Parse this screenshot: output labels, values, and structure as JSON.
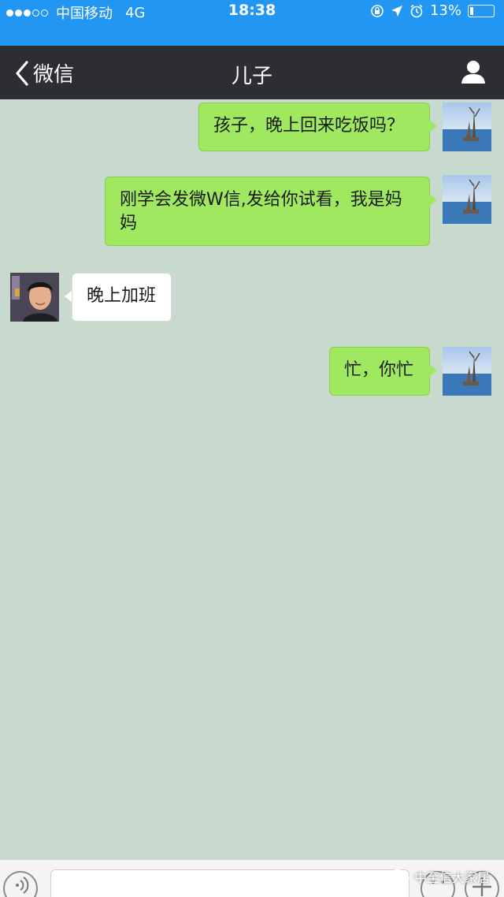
{
  "status_bar": {
    "carrier": "中国移动",
    "network": "4G",
    "time": "18:38",
    "battery": "13%"
  },
  "banner": {
    "text": "..."
  },
  "nav": {
    "back_label": "微信",
    "title": "儿子"
  },
  "messages": [
    {
      "sender": "me",
      "text": "孩子，晚上回来吃饭吗？"
    },
    {
      "sender": "me",
      "text": "刚学会发微W信,发给你试看，我是妈妈"
    },
    {
      "sender": "other",
      "text": "晚上加班"
    },
    {
      "sender": "me",
      "text": "忙，你忙"
    }
  ],
  "watermark": {
    "text": "中至信大家居"
  },
  "colors": {
    "status_bar": "#2196f3",
    "nav_bar": "#2c2e32",
    "chat_background": "#c8d9cd",
    "my_bubble": "#9fe85f",
    "other_bubble": "#ffffff"
  },
  "icons": [
    "back-chevron-icon",
    "profile-icon",
    "voice-icon",
    "emoji-icon",
    "plus-icon",
    "location-icon",
    "alarm-icon",
    "wechat-logo-icon"
  ]
}
